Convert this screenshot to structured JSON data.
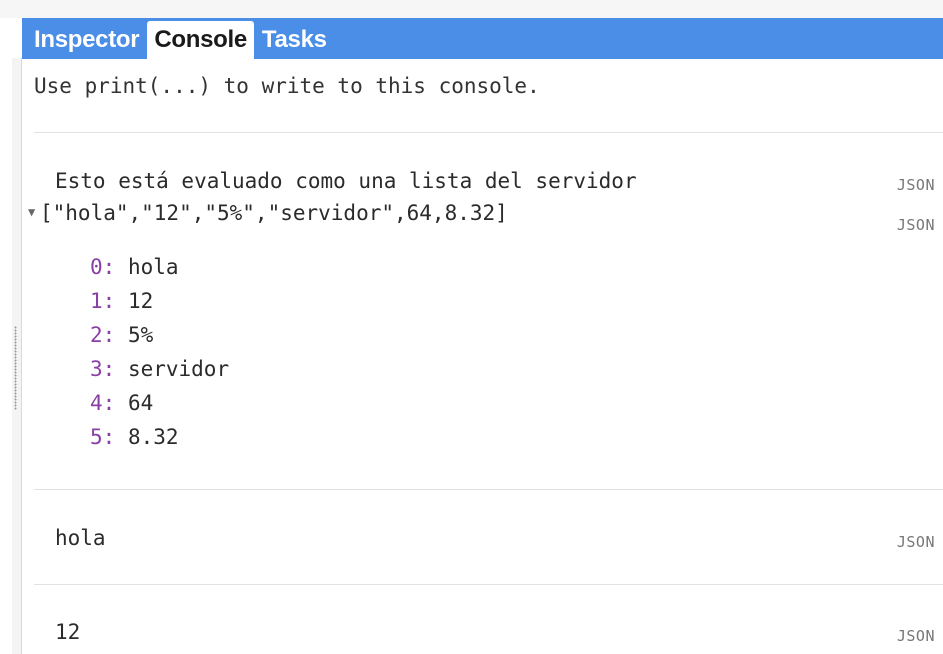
{
  "tabs": [
    {
      "label": "Inspector",
      "active": false
    },
    {
      "label": "Console",
      "active": true
    },
    {
      "label": "Tasks",
      "active": false
    }
  ],
  "colors": {
    "tab_bar": "#4a8ee8",
    "index_color": "#8a3fa4"
  },
  "console": {
    "intro": "Use print(...) to write to this console.",
    "entries": [
      {
        "text": "Esto está evaluado como una lista del servidor",
        "tag": "JSON"
      },
      {
        "text": "[\"hola\",\"12\",\"5%\",\"servidor\",64,8.32]",
        "tag": "JSON",
        "expanded": true,
        "items": [
          {
            "index": "0:",
            "value": "hola"
          },
          {
            "index": "1:",
            "value": "12"
          },
          {
            "index": "2:",
            "value": "5%"
          },
          {
            "index": "3:",
            "value": "servidor"
          },
          {
            "index": "4:",
            "value": "64"
          },
          {
            "index": "5:",
            "value": "8.32"
          }
        ]
      },
      {
        "text": "hola",
        "tag": "JSON"
      },
      {
        "text": "12",
        "tag": "JSON"
      }
    ]
  }
}
